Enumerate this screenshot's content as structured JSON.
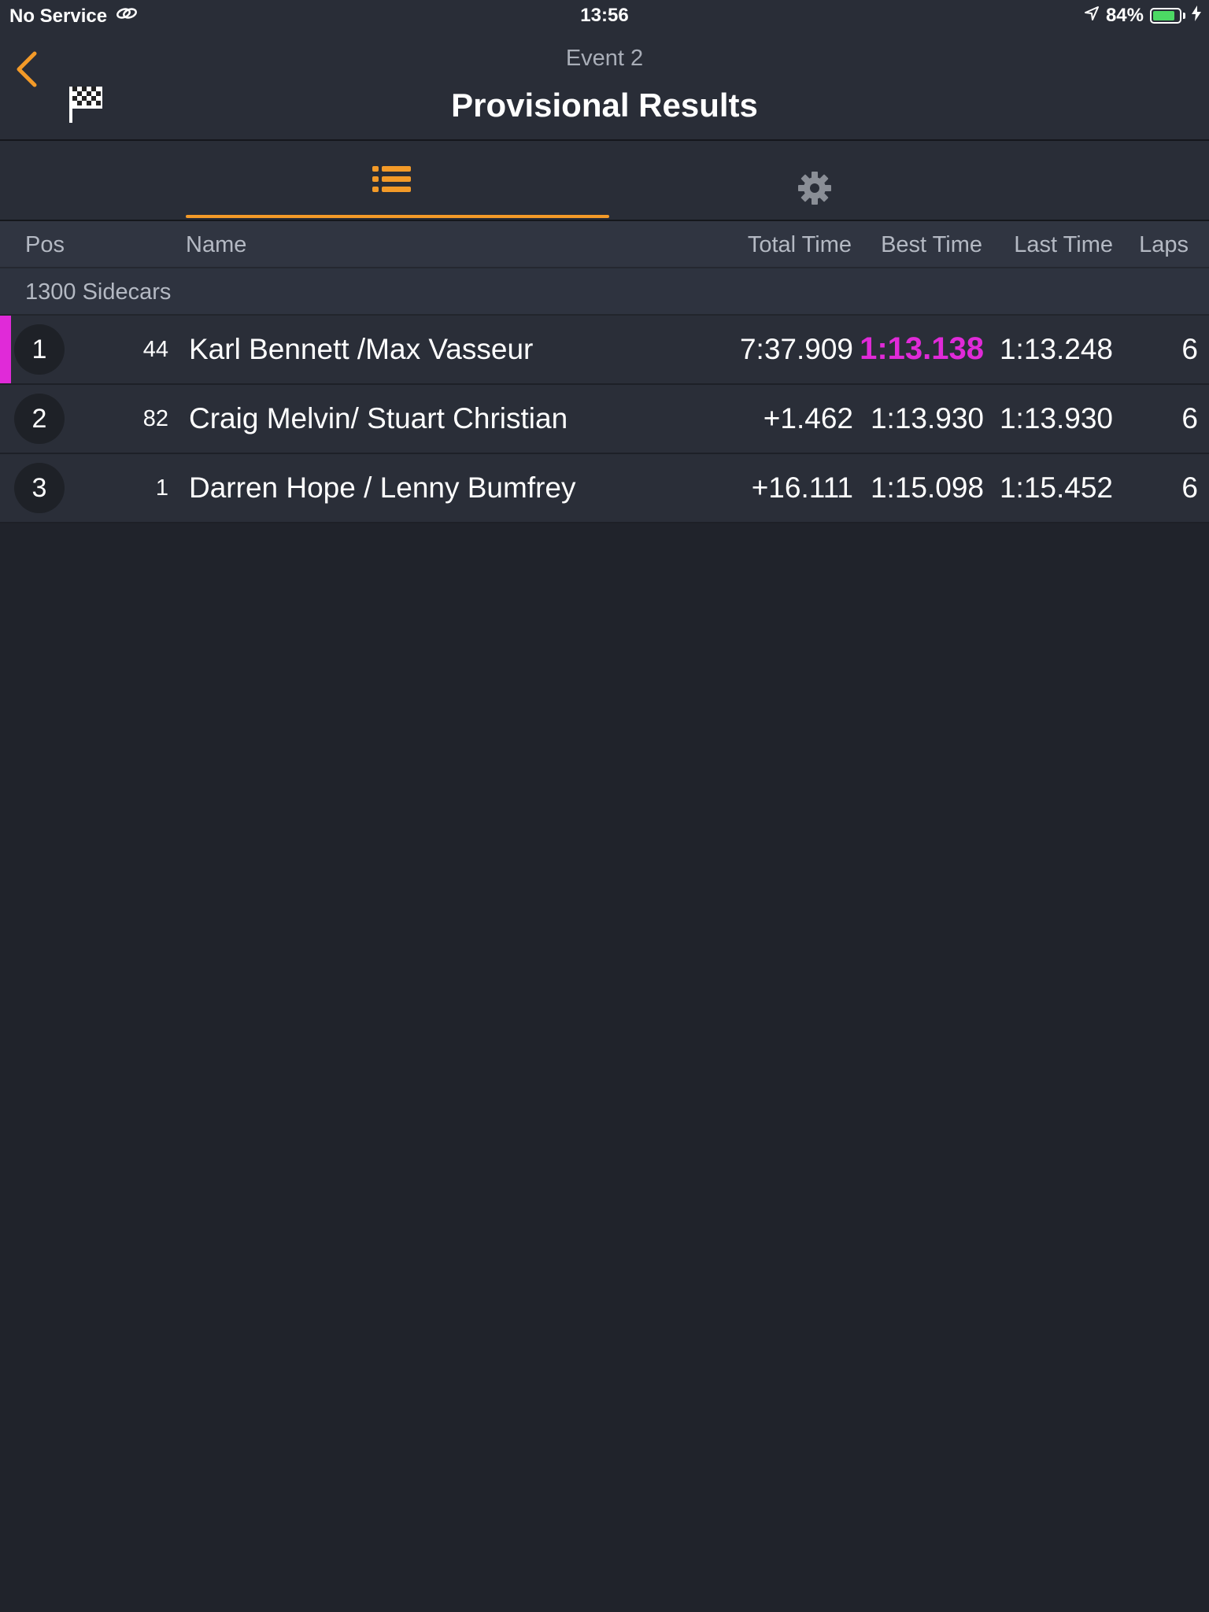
{
  "status_bar": {
    "carrier": "No Service",
    "time": "13:56",
    "battery_text": "84%",
    "battery_level": 0.84,
    "icons": [
      "link-icon",
      "location-arrow-icon",
      "battery-icon",
      "charging-bolt-icon"
    ]
  },
  "nav": {
    "subtitle": "Event 2",
    "title": "Provisional Results",
    "icons": [
      "back-chevron-icon",
      "checkered-flag-icon"
    ]
  },
  "tabs": {
    "items": [
      {
        "icon": "list-icon",
        "selected": true
      },
      {
        "icon": "gear-icon",
        "selected": false
      }
    ],
    "accent_color": "#f39a28",
    "inactive_icon_color": "#8a8e96"
  },
  "columns": {
    "pos": "Pos",
    "name": "Name",
    "total_time": "Total Time",
    "best_time": "Best Time",
    "last_time": "Last Time",
    "laps": "Laps"
  },
  "group": {
    "label": "1300 Sidecars"
  },
  "results": [
    {
      "pos": "1",
      "number": "44",
      "name": "Karl Bennett /Max Vasseur",
      "total": "7:37.909",
      "best": "1:13.138",
      "last": "1:13.248",
      "laps": "6",
      "fastest_lap": true
    },
    {
      "pos": "2",
      "number": "82",
      "name": "Craig Melvin/ Stuart Christian",
      "total": "+1.462",
      "best": "1:13.930",
      "last": "1:13.930",
      "laps": "6",
      "fastest_lap": false
    },
    {
      "pos": "3",
      "number": "1",
      "name": "Darren Hope / Lenny Bumfrey",
      "total": "+16.111",
      "best": "1:15.098",
      "last": "1:15.452",
      "laps": "6",
      "fastest_lap": false
    }
  ],
  "colors": {
    "background": "#20232b",
    "fastest_lap": "#e02ad8",
    "accent": "#f39a28"
  }
}
